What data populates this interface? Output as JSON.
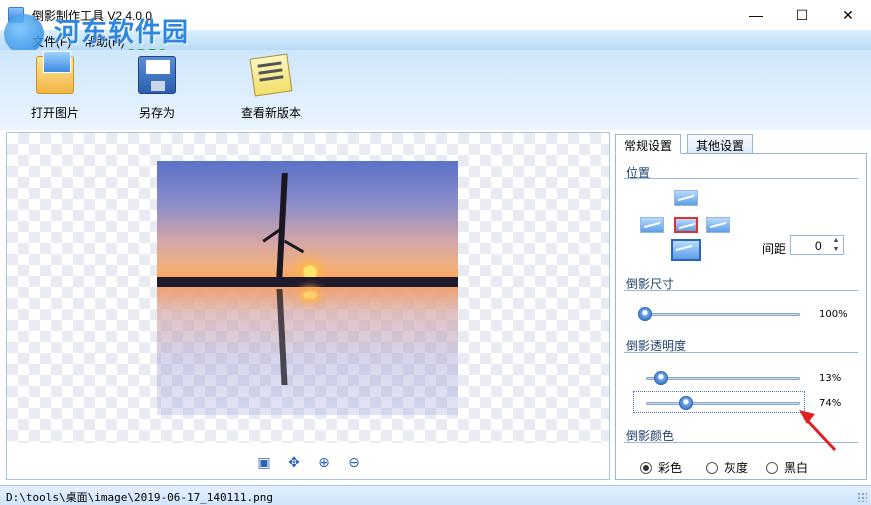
{
  "window": {
    "title": "倒影制作工具 V2.4.0.0",
    "minimize_glyph": "—",
    "maximize_glyph": "☐",
    "close_glyph": "✕"
  },
  "watermark": {
    "site_name": "河东软件园",
    "url": "www.pc0359.cn"
  },
  "menu": {
    "items": [
      "文件(F)",
      "帮助(H)"
    ]
  },
  "toolbar": {
    "open_label": "打开图片",
    "save_as_label": "另存为",
    "check_update_label": "查看新版本"
  },
  "zoom_tools": {
    "icons": [
      "fit-window-icon",
      "actual-size-icon",
      "zoom-in-icon",
      "zoom-out-icon"
    ],
    "glyphs": [
      "▣",
      "✥",
      "⊕",
      "⊖"
    ]
  },
  "panel": {
    "tabs": [
      "常规设置",
      "其他设置"
    ],
    "active_tab": 0,
    "position": {
      "title": "位置",
      "selected": "bottom",
      "spacing_label": "间距",
      "spacing_value": "0",
      "spin_up": "▲",
      "spin_down": "▼"
    },
    "size": {
      "title": "倒影尺寸",
      "value": "100%",
      "level": 1.0
    },
    "opacity": {
      "title": "倒影透明度",
      "start_value": "13%",
      "start_level": 0.13,
      "end_value": "74%",
      "end_level": 0.26
    },
    "color": {
      "title": "倒影颜色",
      "options": [
        "彩色",
        "灰度",
        "黑白"
      ],
      "selected": 0
    }
  },
  "status": {
    "path": "D:\\tools\\桌面\\image\\2019-06-17_140111.png"
  },
  "colors": {
    "accent": "#2b63b8",
    "arrow": "#e02020",
    "watermark_blue": "#2e86de",
    "watermark_green": "#2fa84f"
  }
}
